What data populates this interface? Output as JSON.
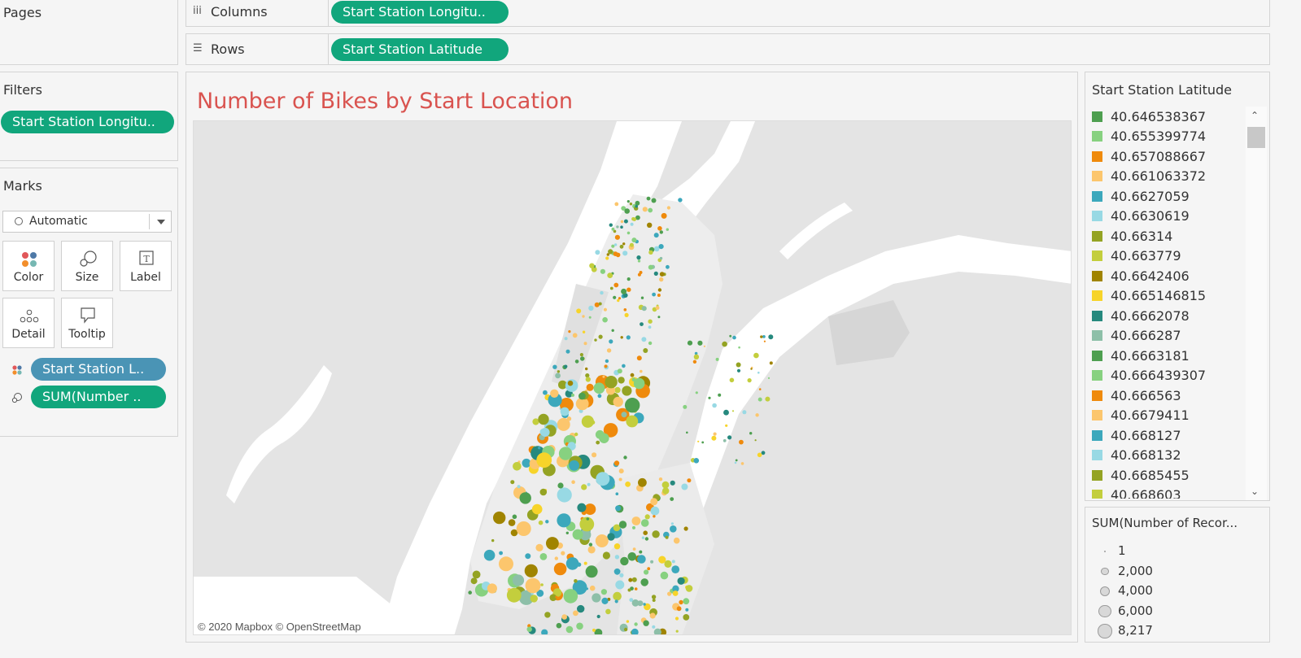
{
  "pages": {
    "title": "Pages"
  },
  "columns": {
    "label": "Columns",
    "pill": "Start Station Longitu.."
  },
  "rows": {
    "label": "Rows",
    "pill": "Start Station Latitude"
  },
  "filters": {
    "title": "Filters",
    "pill": "Start Station Longitu.."
  },
  "marks": {
    "title": "Marks",
    "type": "Automatic",
    "buttons": {
      "color": "Color",
      "size": "Size",
      "label": "Label",
      "detail": "Detail",
      "tooltip": "Tooltip"
    },
    "pill_color": "Start Station L..",
    "pill_size": "SUM(Number .."
  },
  "viz": {
    "title": "Number of Bikes by Start Location",
    "title_color": "#d9534f",
    "attribution": "© 2020 Mapbox © OpenStreetMap"
  },
  "legend_color": {
    "title": "Start Station Latitude",
    "items": [
      {
        "label": "40.646538367",
        "color": "#4e9f50"
      },
      {
        "label": "40.655399774",
        "color": "#87d180"
      },
      {
        "label": "40.657088667",
        "color": "#ef8a0c"
      },
      {
        "label": "40.661063372",
        "color": "#fcc66d"
      },
      {
        "label": "40.6627059",
        "color": "#3ca8bc"
      },
      {
        "label": "40.6630619",
        "color": "#98d9e4"
      },
      {
        "label": "40.66314",
        "color": "#94a323"
      },
      {
        "label": "40.663779",
        "color": "#c3ce3d"
      },
      {
        "label": "40.6642406",
        "color": "#a08400"
      },
      {
        "label": "40.665146815",
        "color": "#f7d42a"
      },
      {
        "label": "40.6662078",
        "color": "#26897e"
      },
      {
        "label": "40.666287",
        "color": "#8dbfa8"
      },
      {
        "label": "40.6663181",
        "color": "#4e9f50"
      },
      {
        "label": "40.666439307",
        "color": "#87d180"
      },
      {
        "label": "40.666563",
        "color": "#ef8a0c"
      },
      {
        "label": "40.6679411",
        "color": "#fcc66d"
      },
      {
        "label": "40.668127",
        "color": "#3ca8bc"
      },
      {
        "label": "40.668132",
        "color": "#98d9e4"
      },
      {
        "label": "40.6685455",
        "color": "#94a323"
      },
      {
        "label": "40.668603",
        "color": "#c3ce3d"
      }
    ]
  },
  "legend_size": {
    "title": "SUM(Number of Recor...",
    "items": [
      {
        "label": "1",
        "value": 1
      },
      {
        "label": "2,000",
        "value": 2000
      },
      {
        "label": "4,000",
        "value": 4000
      },
      {
        "label": "6,000",
        "value": 6000
      },
      {
        "label": "8,217",
        "value": 8217
      }
    ]
  }
}
